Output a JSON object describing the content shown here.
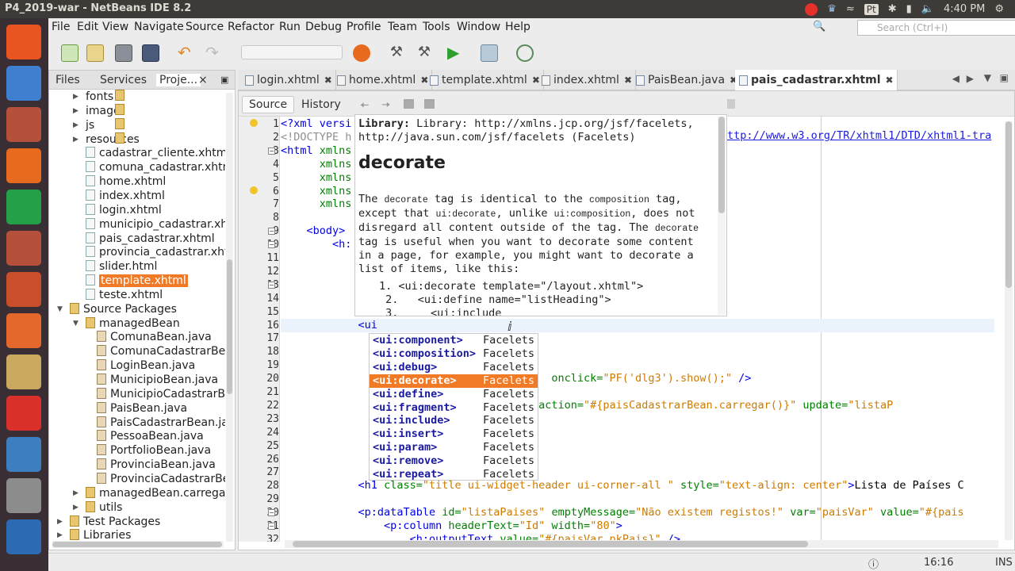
{
  "window": {
    "title": "P4_2019-war - NetBeans IDE 8.2"
  },
  "tray": {
    "keyboard": "Pt",
    "time": "4:40 PM"
  },
  "launcher": {
    "items": [
      {
        "name": "dash-icon",
        "color": "#e95420"
      },
      {
        "name": "libreoffice-writer-icon",
        "color": "#3f7fd0"
      },
      {
        "name": "files-icon",
        "color": "#b5503a"
      },
      {
        "name": "firefox-icon",
        "color": "#e76a1f"
      },
      {
        "name": "libreoffice-calc-icon",
        "color": "#24a148"
      },
      {
        "name": "files-icon",
        "color": "#b5503a"
      },
      {
        "name": "libreoffice-impress-icon",
        "color": "#c94e2a"
      },
      {
        "name": "software-center-icon",
        "color": "#e4682b"
      },
      {
        "name": "amazon-icon",
        "color": "#caa860"
      },
      {
        "name": "youtube-icon",
        "color": "#d9302b"
      },
      {
        "name": "virtualbox-icon",
        "color": "#3d7ec1"
      },
      {
        "name": "terminal-icon",
        "color": "#8c8c8c"
      },
      {
        "name": "netbeans-icon",
        "color": "#2c6bb3"
      }
    ]
  },
  "menu": [
    "File",
    "Edit",
    "View",
    "Navigate",
    "Source",
    "Refactor",
    "Run",
    "Debug",
    "Profile",
    "Team",
    "Tools",
    "Window",
    "Help"
  ],
  "search": {
    "placeholder": "Search (Ctrl+I)"
  },
  "left_tabs": [
    "Files",
    "Services",
    "Proje...",
    "×"
  ],
  "tree": [
    {
      "label": "fonts",
      "indent": 1,
      "type": "fold",
      "toggle": "▶"
    },
    {
      "label": "image",
      "indent": 1,
      "type": "fold",
      "toggle": "▶"
    },
    {
      "label": "js",
      "indent": 1,
      "type": "fold",
      "toggle": "▶"
    },
    {
      "label": "resources",
      "indent": 1,
      "type": "fold",
      "toggle": "▶"
    },
    {
      "label": "cadastrar_cliente.xhtml",
      "indent": 1,
      "type": "file"
    },
    {
      "label": "comuna_cadastrar.xhtml",
      "indent": 1,
      "type": "file"
    },
    {
      "label": "home.xhtml",
      "indent": 1,
      "type": "file"
    },
    {
      "label": "index.xhtml",
      "indent": 1,
      "type": "file"
    },
    {
      "label": "login.xhtml",
      "indent": 1,
      "type": "file"
    },
    {
      "label": "municipio_cadastrar.xhtml",
      "indent": 1,
      "type": "file"
    },
    {
      "label": "pais_cadastrar.xhtml",
      "indent": 1,
      "type": "file"
    },
    {
      "label": "provincia_cadastrar.xhtml",
      "indent": 1,
      "type": "file"
    },
    {
      "label": "slider.html",
      "indent": 1,
      "type": "file"
    },
    {
      "label": "template.xhtml",
      "indent": 1,
      "type": "file",
      "selected": true
    },
    {
      "label": "teste.xhtml",
      "indent": 1,
      "type": "file"
    },
    {
      "label": "Source Packages",
      "indent": 0,
      "type": "pkg",
      "toggle": "▼"
    },
    {
      "label": "managedBean",
      "indent": 1,
      "type": "pkg",
      "toggle": "▼"
    },
    {
      "label": "ComunaBean.java",
      "indent": 2,
      "type": "jv"
    },
    {
      "label": "ComunaCadastrarBean.java",
      "indent": 2,
      "type": "jv"
    },
    {
      "label": "LoginBean.java",
      "indent": 2,
      "type": "jv"
    },
    {
      "label": "MunicipioBean.java",
      "indent": 2,
      "type": "jv"
    },
    {
      "label": "MunicipioCadastrarBean.java",
      "indent": 2,
      "type": "jv"
    },
    {
      "label": "PaisBean.java",
      "indent": 2,
      "type": "jv"
    },
    {
      "label": "PaisCadastrarBean.java",
      "indent": 2,
      "type": "jv"
    },
    {
      "label": "PessoaBean.java",
      "indent": 2,
      "type": "jv"
    },
    {
      "label": "PortfolioBean.java",
      "indent": 2,
      "type": "jv"
    },
    {
      "label": "ProvinciaBean.java",
      "indent": 2,
      "type": "jv"
    },
    {
      "label": "ProvinciaCadastrarBean.java",
      "indent": 2,
      "type": "jv"
    },
    {
      "label": "managedBean.carregar",
      "indent": 1,
      "type": "pkg",
      "toggle": "▶"
    },
    {
      "label": "utils",
      "indent": 1,
      "type": "pkg",
      "toggle": "▶"
    },
    {
      "label": "Test Packages",
      "indent": 0,
      "type": "pkg",
      "toggle": "▶"
    },
    {
      "label": "Libraries",
      "indent": 0,
      "type": "pkg",
      "toggle": "▶"
    }
  ],
  "editor_tabs": [
    "login.xhtml",
    "home.xhtml",
    "template.xhtml",
    "index.xhtml",
    "PaisBean.java",
    "pais_cadastrar.xhtml"
  ],
  "active_tab": "pais_cadastrar.xhtml",
  "subbar": {
    "source": "Source",
    "history": "History"
  },
  "line_numbers": [
    "1",
    "2",
    "3",
    "4",
    "5",
    "6",
    "7",
    "8",
    "9",
    "10",
    "11",
    "12",
    "13",
    "14",
    "15",
    "16",
    "17",
    "18",
    "19",
    "20",
    "21",
    "22",
    "23",
    "24",
    "25",
    "26",
    "27",
    "28",
    "29",
    "30",
    "31",
    "32"
  ],
  "code_lines": [
    {
      "n": 1,
      "html": "<span class='tg'>&lt;?xml versi</span>"
    },
    {
      "n": 2,
      "html": "<span class='cm'>&lt;!DOCTYPE h</span>"
    },
    {
      "n": 3,
      "html": "<span class='tg'>&lt;html</span> <span class='at'>xmlns</span>"
    },
    {
      "n": 4,
      "html": "      <span class='at'>xmlns</span>"
    },
    {
      "n": 5,
      "html": "      <span class='at'>xmlns</span>"
    },
    {
      "n": 6,
      "html": "      <span class='at'>xmlns</span>"
    },
    {
      "n": 7,
      "html": "      <span class='at'>xmlns</span>"
    },
    {
      "n": 9,
      "html": "    <span class='tg'>&lt;body&gt;</span>"
    },
    {
      "n": 10,
      "html": "        <span class='tg'>&lt;h:</span>"
    },
    {
      "n": 16,
      "html": "            <span class='tg'>&lt;ui</span>"
    },
    {
      "n": 17,
      "html": "                                      "
    },
    {
      "n": 18,
      "html": "                           <span class='tg'>/&gt;</span>"
    },
    {
      "n": 20,
      "html": "                           <span class='st'>dastrar Novo\"</span>  <span class='at'>onclick=</span><span class='st'>\"PF('dlg3').show();\"</span> <span class='tg'>/&gt;</span>"
    },
    {
      "n": 22,
      "html": "                           <span class='st'>rregar Exel\"</span> <span class='at'>action=</span><span class='st'>\"#{paisCadastrarBean.carregar()}\"</span> <span class='at'>update=</span><span class='st'>\"listaP</span>"
    },
    {
      "n": 28,
      "html": "            <span class='tg'>&lt;h1</span> <span class='at'>class=</span><span class='st'>\"title ui-widget-header ui-corner-all \"</span> <span class='at'>style=</span><span class='st'>\"text-align: center\"</span><span class='tg'>&gt;</span>Lista de Países C"
    },
    {
      "n": 30,
      "html": "            <span class='tg'>&lt;p:dataTable</span> <span class='at'>id=</span><span class='st'>\"listaPaises\"</span> <span class='at'>emptyMessage=</span><span class='st'>\"Não existem registos!\"</span> <span class='at'>var=</span><span class='st'>\"paisVar\"</span> <span class='at'>value=</span><span class='st'>\"#{pais</span>"
    },
    {
      "n": 31,
      "html": "                <span class='tg'>&lt;p:column</span> <span class='at'>headerText=</span><span class='st'>\"Id\"</span> <span class='at'>width=</span><span class='st'>\"80\"</span><span class='tg'>&gt;</span>"
    },
    {
      "n": 32,
      "html": "                    <span class='tg'>&lt;h:outputText</span> <span class='at'>value=</span><span class='st'>\"#{paisVar.pkPais}\"</span> <span class='tg'>/&gt;</span>"
    }
  ],
  "doctype_url": "ttp://www.w3.org/TR/xhtml1/DTD/xhtml1-tra",
  "doc_popup": {
    "library": "Library: http://xmlns.jcp.org/jsf/facelets,\nhttp://java.sun.com/jsf/facelets (Facelets)",
    "heading": "decorate",
    "p1": "The ",
    "c1": "decorate",
    "p2": " tag is identical to the ",
    "c2": "composition",
    "p3": " tag, except that ",
    "c3": "ui:decorate",
    "p4": ", unlike ",
    "c4": "ui:composition",
    "p5": ", does not disregard all content outside of the tag. The ",
    "c5": "decorate",
    "p6": " tag is useful when you want to decorate some content in a page, for example, you might want to decorate a list of items, like this:",
    "example": "1. <ui:decorate template=\"/layout.xhtml\">\n 2.   <ui:define name=\"listHeading\">\n 3.     <ui:include"
  },
  "completion": {
    "items": [
      {
        "name": "<ui:component>",
        "lib": "Facelets"
      },
      {
        "name": "<ui:composition>",
        "lib": "Facelets"
      },
      {
        "name": "<ui:debug>",
        "lib": "Facelets"
      },
      {
        "name": "<ui:decorate>",
        "lib": "Facelets",
        "selected": true
      },
      {
        "name": "<ui:define>",
        "lib": "Facelets"
      },
      {
        "name": "<ui:fragment>",
        "lib": "Facelets"
      },
      {
        "name": "<ui:include>",
        "lib": "Facelets"
      },
      {
        "name": "<ui:insert>",
        "lib": "Facelets"
      },
      {
        "name": "<ui:param>",
        "lib": "Facelets"
      },
      {
        "name": "<ui:remove>",
        "lib": "Facelets"
      },
      {
        "name": "<ui:repeat>",
        "lib": "Facelets"
      }
    ]
  },
  "status": {
    "position": "16:16",
    "mode": "INS"
  }
}
